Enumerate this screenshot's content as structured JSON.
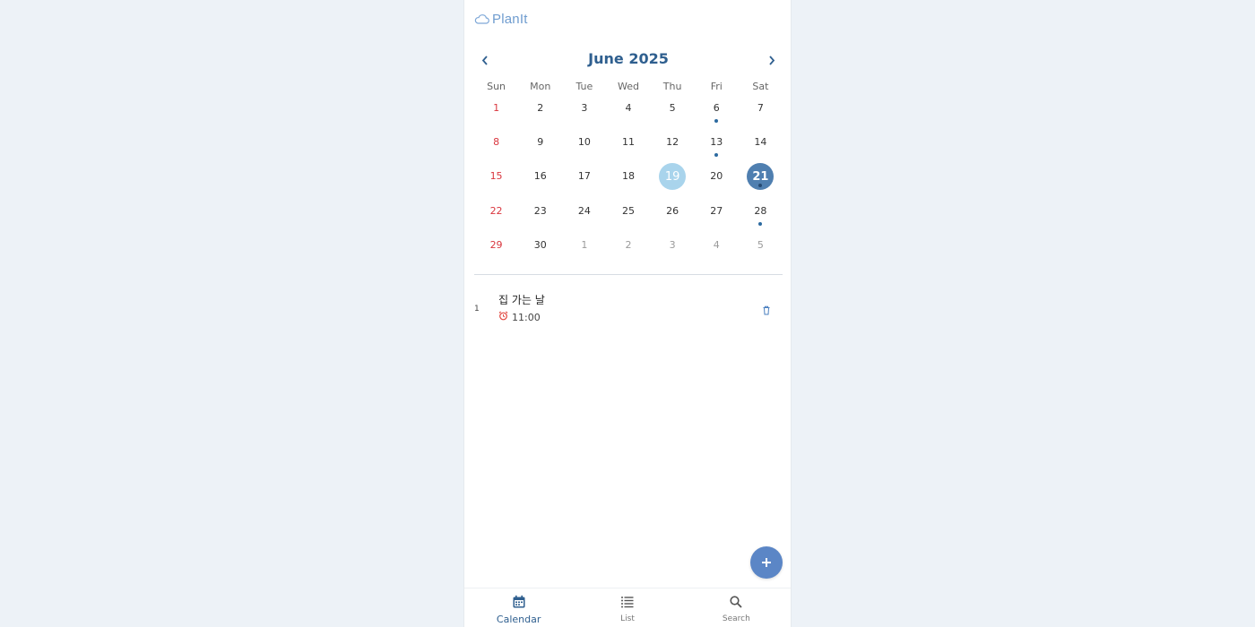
{
  "app": {
    "name": "PlanIt",
    "logo_icon": "cloud-icon"
  },
  "calendar": {
    "month_label": "June 2025",
    "prev_icon": "chevron-left-icon",
    "next_icon": "chevron-right-icon",
    "weekdays": [
      "Sun",
      "Mon",
      "Tue",
      "Wed",
      "Thu",
      "Fri",
      "Sat"
    ],
    "today": 19,
    "selected": 21,
    "days": [
      {
        "num": "1",
        "cur": true,
        "ev": false
      },
      {
        "num": "2",
        "cur": true,
        "ev": false
      },
      {
        "num": "3",
        "cur": true,
        "ev": false
      },
      {
        "num": "4",
        "cur": true,
        "ev": false
      },
      {
        "num": "5",
        "cur": true,
        "ev": false
      },
      {
        "num": "6",
        "cur": true,
        "ev": true
      },
      {
        "num": "7",
        "cur": true,
        "ev": false
      },
      {
        "num": "8",
        "cur": true,
        "ev": false
      },
      {
        "num": "9",
        "cur": true,
        "ev": false
      },
      {
        "num": "10",
        "cur": true,
        "ev": false
      },
      {
        "num": "11",
        "cur": true,
        "ev": false
      },
      {
        "num": "12",
        "cur": true,
        "ev": false
      },
      {
        "num": "13",
        "cur": true,
        "ev": true
      },
      {
        "num": "14",
        "cur": true,
        "ev": false
      },
      {
        "num": "15",
        "cur": true,
        "ev": false
      },
      {
        "num": "16",
        "cur": true,
        "ev": false
      },
      {
        "num": "17",
        "cur": true,
        "ev": false
      },
      {
        "num": "18",
        "cur": true,
        "ev": false
      },
      {
        "num": "19",
        "cur": true,
        "ev": false
      },
      {
        "num": "20",
        "cur": true,
        "ev": false
      },
      {
        "num": "21",
        "cur": true,
        "ev": true
      },
      {
        "num": "22",
        "cur": true,
        "ev": false
      },
      {
        "num": "23",
        "cur": true,
        "ev": false
      },
      {
        "num": "24",
        "cur": true,
        "ev": false
      },
      {
        "num": "25",
        "cur": true,
        "ev": false
      },
      {
        "num": "26",
        "cur": true,
        "ev": false
      },
      {
        "num": "27",
        "cur": true,
        "ev": false
      },
      {
        "num": "28",
        "cur": true,
        "ev": true
      },
      {
        "num": "29",
        "cur": true,
        "ev": false
      },
      {
        "num": "30",
        "cur": true,
        "ev": false
      },
      {
        "num": "1",
        "cur": false,
        "ev": false
      },
      {
        "num": "2",
        "cur": false,
        "ev": false
      },
      {
        "num": "3",
        "cur": false,
        "ev": false
      },
      {
        "num": "4",
        "cur": false,
        "ev": false
      },
      {
        "num": "5",
        "cur": false,
        "ev": false
      }
    ]
  },
  "events": [
    {
      "index": "1",
      "title": "집 가는 날",
      "time": "11:00",
      "time_icon": "alarm-clock-icon",
      "delete_icon": "trash-icon"
    }
  ],
  "fab": {
    "icon": "plus-icon"
  },
  "tabs": [
    {
      "label": "Calendar",
      "icon": "calendar-icon",
      "active": true
    },
    {
      "label": "List",
      "icon": "list-icon",
      "active": false
    },
    {
      "label": "Search",
      "icon": "search-icon",
      "active": false
    }
  ],
  "colors": {
    "accent": "#2f5f8f",
    "today_circle": "#a9d4ec",
    "selected_circle": "#4f7fb0",
    "sunday": "#d9363e",
    "event_dot": "#2c6aa0",
    "fab": "#5b86c6",
    "page_bg": "#edf2f7"
  }
}
